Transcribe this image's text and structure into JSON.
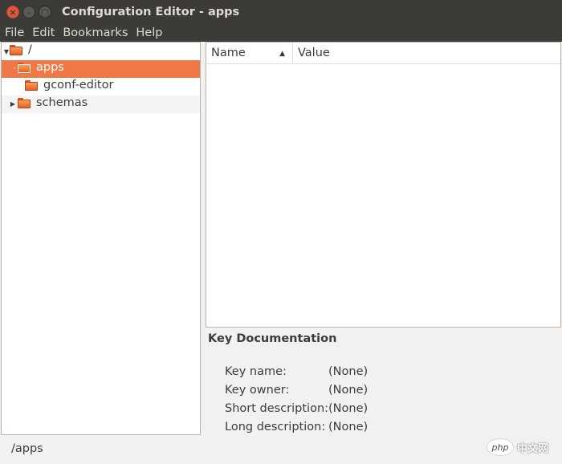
{
  "window": {
    "title": "Configuration Editor - apps",
    "close_glyph": "×",
    "min_glyph": "–",
    "max_glyph": "□"
  },
  "menu": [
    "File",
    "Edit",
    "Bookmarks",
    "Help"
  ],
  "tree": {
    "rows": [
      {
        "label": "/",
        "expanded": true
      },
      {
        "label": "apps",
        "expanded": true,
        "selected": true
      },
      {
        "label": "gconf-editor"
      },
      {
        "label": "schemas",
        "expanded": false
      }
    ],
    "colors": {
      "selection": "#f07746"
    }
  },
  "list": {
    "columns": [
      "Name",
      "Value"
    ],
    "sort_column": "Name",
    "sort_direction": "ascending"
  },
  "key_doc": {
    "title": "Key Documentation",
    "fields": [
      {
        "label": "Key name:",
        "value": "(None)"
      },
      {
        "label": "Key owner:",
        "value": "(None)"
      },
      {
        "label": "Short description:",
        "value": "(None)"
      },
      {
        "label": "Long description:",
        "value": "(None)"
      }
    ]
  },
  "status": {
    "path": "/apps"
  },
  "watermark": {
    "logo": "php",
    "text": "中文网"
  }
}
